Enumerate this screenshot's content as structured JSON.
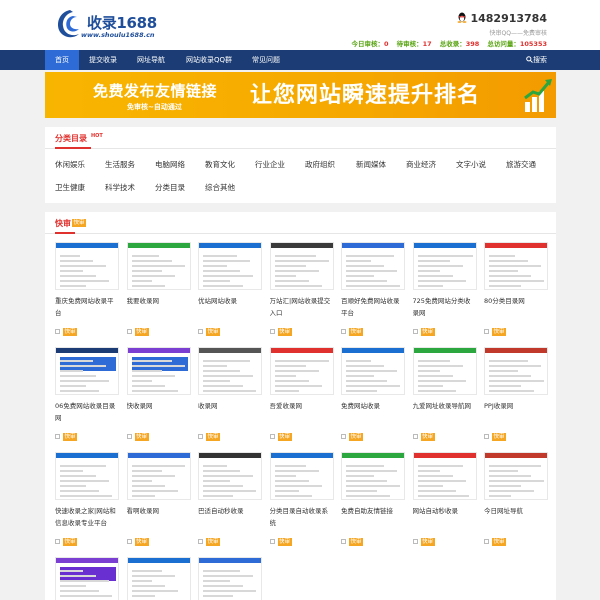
{
  "header": {
    "logo_title": "收录1688",
    "logo_url": "www.shoulu1688.cn",
    "phone": "1482913784",
    "qq_note": "快审QQ——免费审核",
    "stats": [
      {
        "label": "今日审核：",
        "value": "0"
      },
      {
        "label": "待审核：",
        "value": "17"
      },
      {
        "label": "总收录：",
        "value": "398"
      },
      {
        "label": "总访问量：",
        "value": "105353"
      }
    ]
  },
  "nav": {
    "items": [
      "首页",
      "提交收录",
      "网址导航",
      "网站收录QQ群",
      "常见问题"
    ],
    "search": "搜索"
  },
  "banner": {
    "line1": "免费发布友情链接",
    "line2": "免审核~自动通过",
    "line3": "让您网站瞬速提升排名"
  },
  "categories": {
    "title": "分类目录",
    "hot": "HOT",
    "items": [
      "休闲娱乐",
      "生活服务",
      "电脑网络",
      "教育文化",
      "行业企业",
      "政府组织",
      "新闻媒体",
      "商业经济",
      "文字小说",
      "旅游交通",
      "卫生健康",
      "科学技术",
      "分类目录",
      "综合其他"
    ]
  },
  "quick": {
    "title": "快审",
    "badge": "快审",
    "sites": [
      "重庆免费网站收录平台",
      "我要收录网",
      "优站网站收录",
      "万站汇|网站收录提交入口",
      "百顺好免费网站收录平台",
      "725免费网站分类收录网",
      "80分类目录网",
      "06免费网站收录目录网",
      "快收录网",
      "收录网",
      "吾爱收录网",
      "免费网站收录",
      "九爱网址收录导航网",
      "PPJ收录网",
      "快速收录之家|网站和信息收录专业平台",
      "看啊收录网",
      "巴适自动秒收录",
      "分类目录自动收录系统",
      "免费自助友情链接",
      "网站自动秒收录",
      "今日网址导航",
      "",
      "",
      ""
    ]
  },
  "colors": {
    "nav": "#1b3c74",
    "nav_active": "#2e6bd6",
    "accent": "#e0312e",
    "badge": "#f5a623",
    "banner": "#f8b500"
  }
}
